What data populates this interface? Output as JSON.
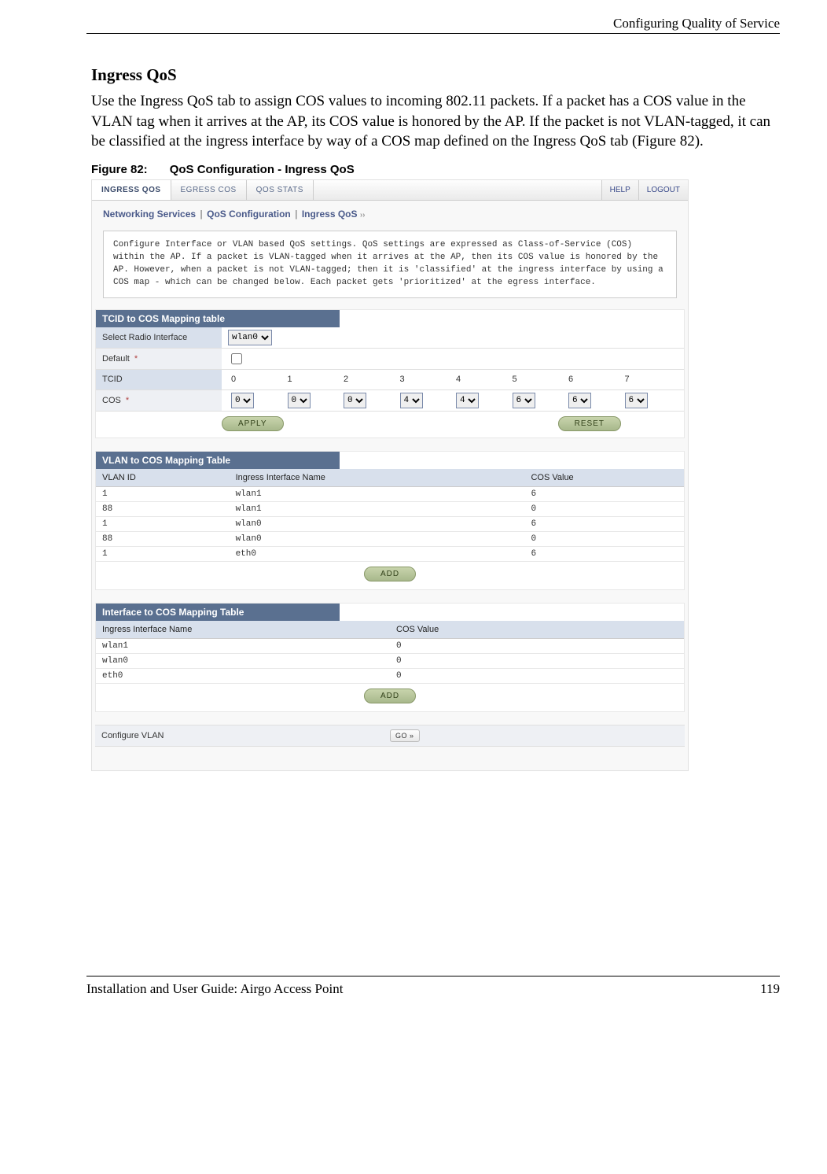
{
  "header": {
    "right": "Configuring Quality of Service"
  },
  "section_title": "Ingress QoS",
  "body_text": "Use the Ingress QoS tab to assign COS values to incoming 802.11 packets. If a packet has a COS value in the VLAN tag when it arrives at the AP, its COS value is honored by the AP. If the packet is not VLAN-tagged, it can be classified at the ingress interface by way of a COS map defined on the Ingress QoS tab (Figure 82).",
  "figure_caption_prefix": "Figure 82:",
  "figure_caption_title": "QoS Configuration - Ingress QoS",
  "tabs": {
    "ingress": "INGRESS QOS",
    "egress": "EGRESS COS",
    "stats": "QOS STATS",
    "help": "HELP",
    "logout": "LOGOUT"
  },
  "breadcrumb": {
    "a": "Networking Services",
    "b": "QoS Configuration",
    "c": "Ingress QoS"
  },
  "desc_text": "Configure Interface or VLAN based QoS settings. QoS settings are expressed as Class-of-Service (COS) within the AP. If a packet is VLAN-tagged when it arrives at the AP, then its COS value is honored by the AP. However, when a packet is not VLAN-tagged; then it is 'classified' at the ingress interface by using a COS map - which can be changed below. Each packet gets 'prioritized' at the egress interface.",
  "tcid_section": {
    "title": "TCID to COS Mapping table",
    "radio_label": "Select Radio Interface",
    "radio_value": "wlan0",
    "default_label": "Default",
    "tcid_label": "TCID",
    "tcid_values": [
      "0",
      "1",
      "2",
      "3",
      "4",
      "5",
      "6",
      "7"
    ],
    "cos_label": "COS",
    "cos_values": [
      "0",
      "0",
      "0",
      "4",
      "4",
      "6",
      "6",
      "6"
    ],
    "apply": "APPLY",
    "reset": "RESET"
  },
  "vlan_section": {
    "title": "VLAN to COS Mapping Table",
    "headers": [
      "VLAN ID",
      "Ingress Interface Name",
      "COS Value"
    ],
    "rows": [
      [
        "1",
        "wlan1",
        "6"
      ],
      [
        "88",
        "wlan1",
        "0"
      ],
      [
        "1",
        "wlan0",
        "6"
      ],
      [
        "88",
        "wlan0",
        "0"
      ],
      [
        "1",
        "eth0",
        "6"
      ]
    ],
    "add": "ADD"
  },
  "iface_section": {
    "title": "Interface to COS Mapping Table",
    "headers": [
      "Ingress Interface Name",
      "COS Value"
    ],
    "rows": [
      [
        "wlan1",
        "0"
      ],
      [
        "wlan0",
        "0"
      ],
      [
        "eth0",
        "0"
      ]
    ],
    "add": "ADD"
  },
  "configure_vlan": {
    "label": "Configure VLAN",
    "go": "GO »"
  },
  "footer": {
    "left": "Installation and User Guide: Airgo Access Point",
    "right": "119"
  }
}
